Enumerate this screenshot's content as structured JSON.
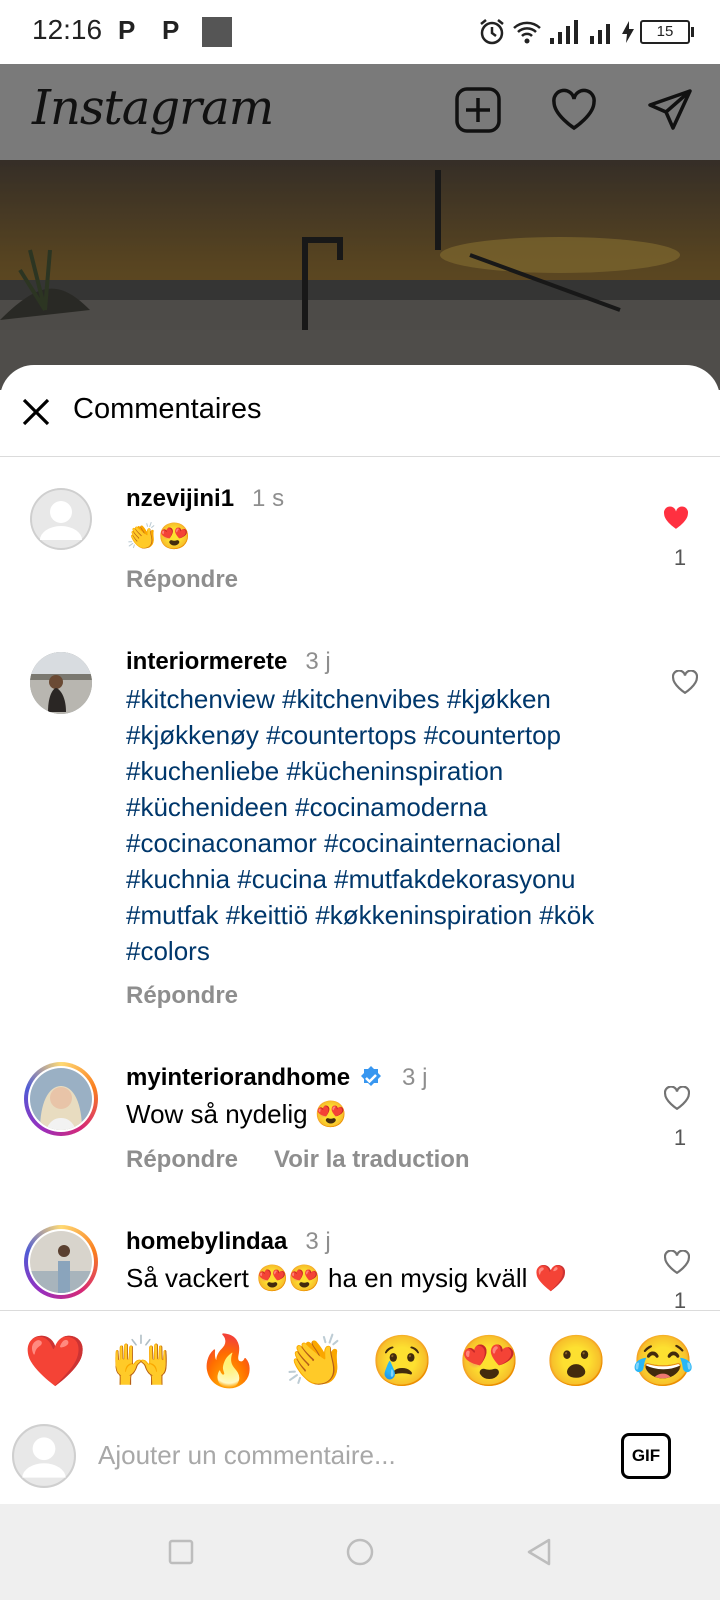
{
  "status_bar": {
    "time": "12:16",
    "p1": "P",
    "p2": "P",
    "battery": "15"
  },
  "header": {
    "logo": "Instagram"
  },
  "sheet": {
    "title": "Commentaires"
  },
  "comments": [
    {
      "username": "nzevijini1",
      "time": "1 s",
      "text": "👏😍",
      "reply": "Répondre",
      "likes": "1",
      "liked": true
    },
    {
      "username": "interiormerete",
      "time": "3 j",
      "lines": [
        "#kitchenview #kitchenvibes #kjøkken",
        "#kjøkkenøy #countertops #countertop",
        "#kuchenliebe #kücheninspiration",
        "#küchenideen #cocinamoderna",
        "#cocinaconamor #cocinainternacional",
        "#kuchnia #cucina #mutfakdekorasyonu",
        "#mutfak #keittiö #køkkeninspiration #kök",
        "#colors"
      ],
      "reply": "Répondre",
      "liked": false
    },
    {
      "username": "myinteriorandhome",
      "time": "3 j",
      "text": "Wow så nydelig 😍",
      "reply": "Répondre",
      "translate": "Voir la traduction",
      "likes": "1",
      "liked": false,
      "verified": true
    },
    {
      "username": "homebylindaa",
      "time": "3 j",
      "text": "Så vackert 😍😍 ha en mysig kväll ❤️",
      "likes": "1",
      "liked": false
    }
  ],
  "emoji_bar": [
    "❤️",
    "🙌",
    "🔥",
    "👏",
    "😢",
    "😍",
    "😮",
    "😂"
  ],
  "comment_input": {
    "placeholder": "Ajouter un commentaire...",
    "gif_label": "GIF"
  },
  "colors": {
    "like_red": "#ff3040",
    "hashtag_blue": "#00376b",
    "muted": "#8e8e8e",
    "verified_blue": "#3897f0"
  }
}
